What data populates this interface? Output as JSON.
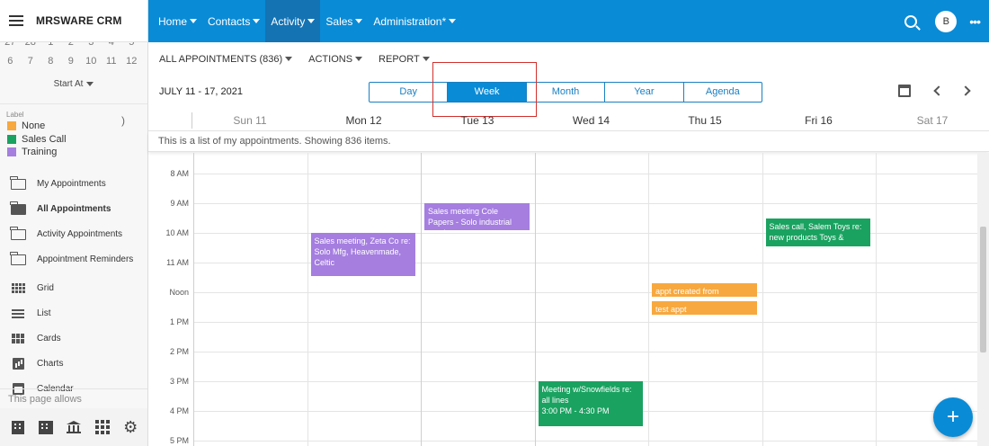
{
  "app": {
    "brand": "MRSWARE CRM"
  },
  "topnav": {
    "items": [
      {
        "label": "Home"
      },
      {
        "label": "Contacts"
      },
      {
        "label": "Activity"
      },
      {
        "label": "Sales"
      },
      {
        "label": "Administration*"
      }
    ],
    "active": "Activity",
    "avatar_initial": "B"
  },
  "minical": {
    "row1": [
      "27",
      "28",
      "1",
      "2",
      "3",
      "4",
      "5"
    ],
    "row2": [
      "6",
      "7",
      "8",
      "9",
      "10",
      "11",
      "12"
    ]
  },
  "start_at_label": "Start At",
  "legend": {
    "heading": "Label",
    "items": [
      {
        "label": "None",
        "color": "#f7a83e"
      },
      {
        "label": "Sales Call",
        "color": "#1aa260"
      },
      {
        "label": "Training",
        "color": "#a57ee0"
      }
    ]
  },
  "sidebar_nav": [
    {
      "label": "My Appointments",
      "icon": "folder-icon"
    },
    {
      "label": "All Appointments",
      "icon": "folder-filled-icon",
      "active": true
    },
    {
      "label": "Activity Appointments",
      "icon": "folder-icon"
    },
    {
      "label": "Appointment Reminders",
      "icon": "folder-icon"
    },
    {
      "label": "Grid",
      "icon": "grid-icon"
    },
    {
      "label": "List",
      "icon": "list-icon"
    },
    {
      "label": "Cards",
      "icon": "cards-icon"
    },
    {
      "label": "Charts",
      "icon": "charts-icon"
    },
    {
      "label": "Calendar",
      "icon": "calendar-icon"
    }
  ],
  "help_text": "This page allows",
  "toolbar": {
    "all_appointments": "ALL APPOINTMENTS (836)",
    "actions": "ACTIONS",
    "report": "REPORT"
  },
  "date_range": "JULY 11 - 17, 2021",
  "views": [
    "Day",
    "Week",
    "Month",
    "Year",
    "Agenda"
  ],
  "active_view": "Week",
  "days": [
    "Sun 11",
    "Mon 12",
    "Tue 13",
    "Wed 14",
    "Thu 15",
    "Fri 16",
    "Sat 17"
  ],
  "prev_day_fragment": ")",
  "info_text": "This is a list of my appointments. Showing 836 items.",
  "hours": [
    "8 AM",
    "9 AM",
    "10 AM",
    "11 AM",
    "Noon",
    "1 PM",
    "2 PM",
    "3 PM",
    "4 PM",
    "5 PM"
  ],
  "events": [
    {
      "day": 2,
      "start": 9.0,
      "end": 9.9,
      "label": "Training",
      "text": "Sales meeting Cole Papers - Solo industrial matting"
    },
    {
      "day": 1,
      "start": 10.0,
      "end": 11.45,
      "label": "Training",
      "text": "Sales meeting, Zeta Co re: Solo Mfg, Heavenmade, Celtic"
    },
    {
      "day": 5,
      "start": 9.5,
      "end": 10.45,
      "label": "Sales Call",
      "text": "Sales call, Salem Toys re: new products Toys &"
    },
    {
      "day": 4,
      "start": 11.7,
      "end": 12.15,
      "label": "None",
      "text": "appt created from"
    },
    {
      "day": 4,
      "start": 12.3,
      "end": 12.75,
      "label": "None",
      "text": "test appt"
    },
    {
      "day": 3,
      "start": 15.0,
      "end": 16.5,
      "label": "Sales Call",
      "text": "Meeting w/Snowfields re: all lines",
      "time": "3:00 PM - 4:30 PM"
    }
  ],
  "fab_label": "+"
}
